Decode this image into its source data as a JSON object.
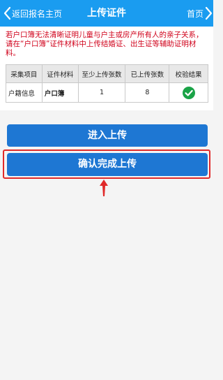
{
  "header": {
    "back_label": "返回报名主页",
    "title": "上传证件",
    "home_label": "首页"
  },
  "notice": "若户口簿无法清晰证明儿童与户主或房产所有人的亲子关系，请在“户口簿”证件材料中上传结婚证、出生证等辅助证明材料。",
  "table": {
    "headers": [
      "采集项目",
      "证件材料",
      "至少上传张数",
      "已上传张数",
      "校验结果"
    ],
    "rows": [
      {
        "item": "户籍信息",
        "material": "户口簿",
        "min_count": "1",
        "uploaded_count": "8",
        "result_icon": "check-circle-icon"
      }
    ]
  },
  "buttons": {
    "upload_label": "进入上传",
    "confirm_label": "确认完成上传"
  },
  "colors": {
    "header_bg": "#1a9cf0",
    "button_bg": "#1e77d3",
    "highlight": "#e02a2a",
    "notice_text": "#d0021b",
    "check": "#1aa347"
  }
}
